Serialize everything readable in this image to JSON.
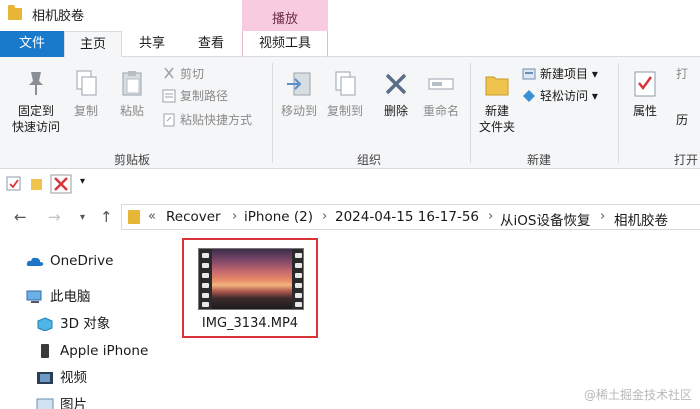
{
  "window": {
    "title": "相机胶卷",
    "context_tab": "播放"
  },
  "tabs": {
    "file": "文件",
    "home": "主页",
    "share": "共享",
    "view": "查看",
    "video_tools": "视频工具"
  },
  "ribbon": {
    "clipboard": {
      "pin_line1": "固定到",
      "pin_line2": "快速访问",
      "copy": "复制",
      "paste": "粘贴",
      "cut": "剪切",
      "copy_path": "复制路径",
      "paste_shortcut": "粘贴快捷方式",
      "group": "剪贴板"
    },
    "organize": {
      "move_to": "移动到",
      "copy_to": "复制到",
      "delete": "删除",
      "rename": "重命名",
      "group": "组织"
    },
    "new": {
      "new_folder_line1": "新建",
      "new_folder_line2": "文件夹",
      "new_item": "新建项目",
      "easy_access": "轻松访问",
      "group": "新建"
    },
    "open": {
      "properties": "属性",
      "group": "打开",
      "partial1": "打",
      "partial3": "历"
    }
  },
  "address": {
    "overflow": "«",
    "crumbs": [
      "Recover",
      "iPhone (2)",
      "2024-04-15 16-17-56",
      "从iOS设备恢复",
      "相机胶卷"
    ],
    "sep": "›"
  },
  "nav": {
    "items": [
      "OneDrive",
      "此电脑",
      "3D 对象",
      "Apple iPhone",
      "视频",
      "图片"
    ]
  },
  "content": {
    "file_name": "IMG_3134.MP4"
  },
  "watermark": "@稀土掘金技术社区",
  "colors": {
    "file_tab": "#1979ca",
    "context_tab": "#f8cbe0",
    "selection_border": "#d9343a"
  }
}
